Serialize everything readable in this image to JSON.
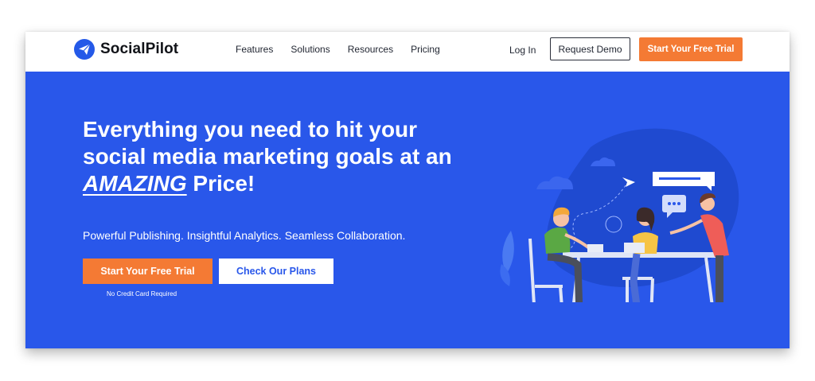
{
  "brand": {
    "name": "SocialPilot"
  },
  "nav": {
    "items": [
      "Features",
      "Solutions",
      "Resources",
      "Pricing"
    ],
    "login": "Log In",
    "demo": "Request Demo",
    "trial": "Start Your Free Trial"
  },
  "hero": {
    "line1": "Everything you need to hit your",
    "line2": "social media marketing goals at an",
    "amazing": "AMAZING",
    "price": " Price!",
    "subline": "Powerful Publishing. Insightful Analytics. Seamless Collaboration.",
    "cta_primary": "Start Your Free Trial",
    "cta_secondary": "Check Our Plans",
    "note": "No Credit Card Required"
  },
  "colors": {
    "hero_bg": "#2957ea",
    "accent_orange": "#f47a34",
    "text_dark": "#1f2430"
  },
  "icons": [
    "paper-plane-logo-icon",
    "paper-plane-icon",
    "chat-bubble-icon"
  ]
}
